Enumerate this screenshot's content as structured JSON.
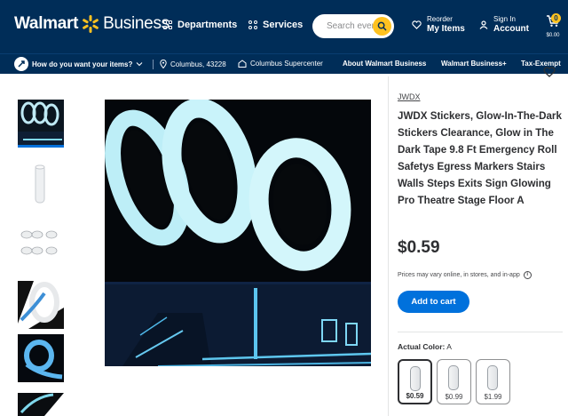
{
  "header": {
    "logo_text": "Walmart",
    "logo_suffix": "Business",
    "departments_label": "Departments",
    "services_label": "Services",
    "search": {
      "placeholder": "Search everything"
    },
    "reorder_small": "Reorder",
    "reorder_big": "My Items",
    "signin_small": "Sign In",
    "signin_big": "Account",
    "cart_count": "0",
    "cart_total": "$0.00",
    "brand_color": "#002d58",
    "accent_color": "#ffc220"
  },
  "subbar": {
    "fulfillment_prompt": "How do you want your items?",
    "location": "Columbus, 43228",
    "store": "Columbus Supercenter",
    "links": [
      "About Walmart Business",
      "Walmart Business+",
      "Tax-Exempt"
    ]
  },
  "gallery": {
    "thumbnails": [
      "glow-tape-rolls",
      "white-tape-roll",
      "tape-rolls-grid",
      "tape-roll-angled",
      "blue-glowing-roll",
      "tape-strip"
    ],
    "selected_index": 0
  },
  "product": {
    "brand": "JWDX",
    "title": "JWDX Stickers, Glow-In-The-Dark Stickers Clearance, Glow in The Dark Tape 9.8 Ft Emergency Roll Safetys Egress Markers Stairs Walls Steps Exits Sign Glowing Pro Theatre Stage Floor A",
    "price": "$0.59",
    "price_note": "Prices may vary online, in stores, and in-app",
    "add_to_cart_label": "Add to cart",
    "color_label": "Actual Color:",
    "color_value": "A",
    "variants": [
      {
        "price": "$0.59",
        "selected": true
      },
      {
        "price": "$0.99",
        "selected": false
      },
      {
        "price": "$1.99",
        "selected": false
      }
    ],
    "button_color": "#0071dc"
  }
}
